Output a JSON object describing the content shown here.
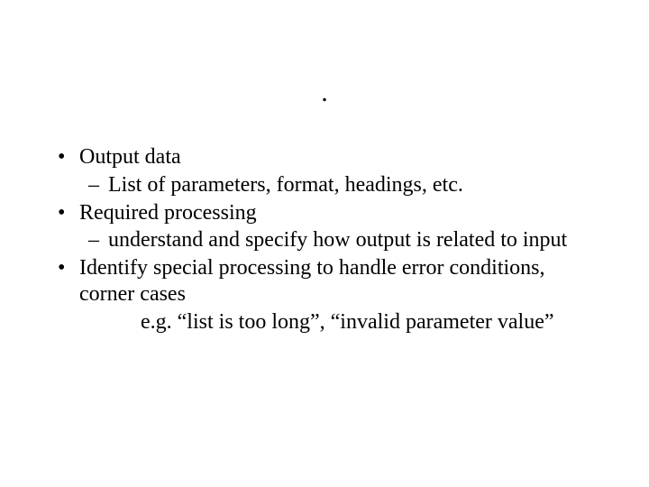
{
  "title_mark": ".",
  "bullets": {
    "b1": {
      "label": "Output data",
      "sub": "List of parameters, format, headings, etc."
    },
    "b2": {
      "label": "Required processing",
      "sub": "understand and specify how output is related to input"
    },
    "b3": {
      "label": "Identify special processing to handle error conditions, corner cases",
      "eg": "e.g. “list is too long”, “invalid parameter value”"
    }
  },
  "glyphs": {
    "bullet": "•",
    "dash": "–"
  }
}
